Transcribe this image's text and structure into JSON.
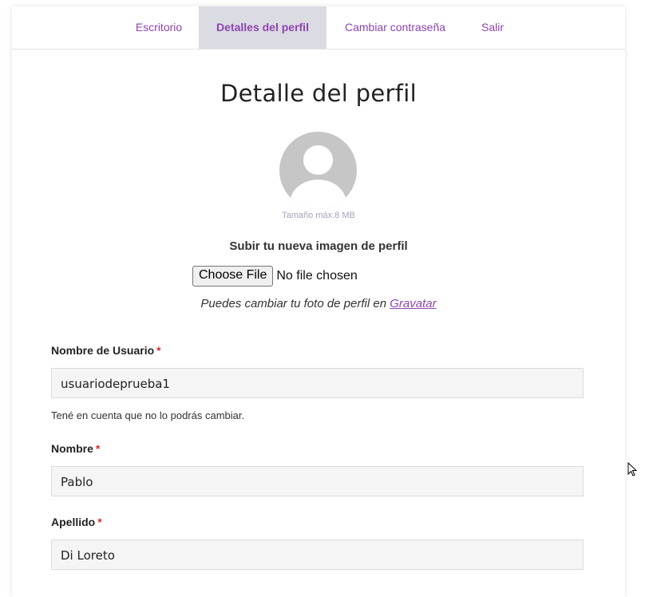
{
  "nav": {
    "tabs": [
      {
        "label": "Escritorio"
      },
      {
        "label": "Detalles del perfil"
      },
      {
        "label": "Cambiar contraseña"
      },
      {
        "label": "Salir"
      }
    ],
    "active_tab": "Detalles del perfil",
    "accent_color": "#8e44ad"
  },
  "page": {
    "title": "Detalle del perfil"
  },
  "avatar": {
    "icon": "default-user-avatar-icon",
    "max_size": "Tamaño máx.8 MB"
  },
  "upload": {
    "label": "Subir tu nueva imagen de perfil",
    "button": "Choose File",
    "status": "No file chosen",
    "gravatar_text": "Puedes cambiar tu foto de perfil en",
    "gravatar_link": "Gravatar"
  },
  "form": {
    "required_mark": "*",
    "username": {
      "label": "Nombre de Usuario",
      "value": "usuariodeprueba1",
      "hint": "Tené en cuenta que no lo podrás cambiar."
    },
    "first_name": {
      "label": "Nombre",
      "value": "Pablo"
    },
    "last_name": {
      "label": "Apellido",
      "value": "Di Loreto"
    }
  }
}
